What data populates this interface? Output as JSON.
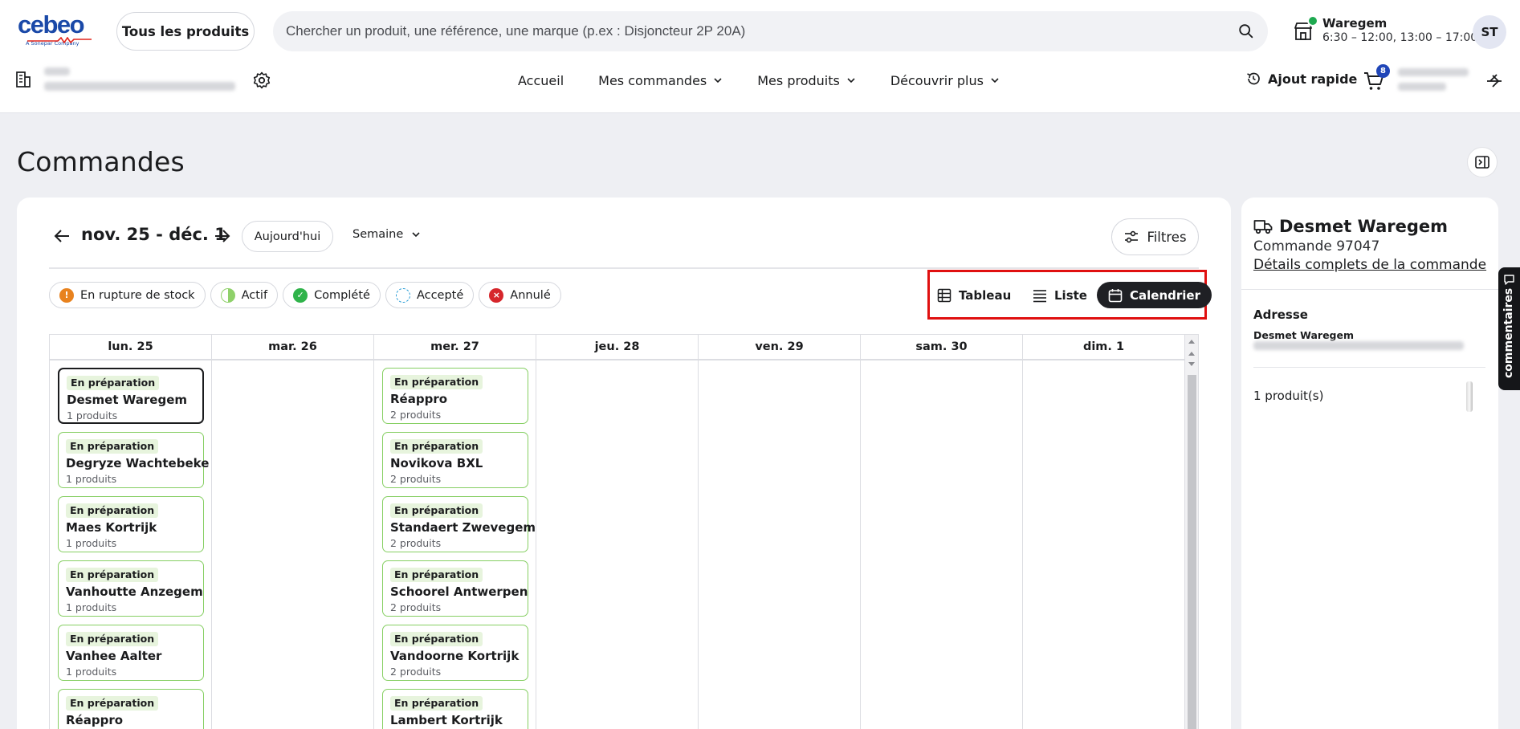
{
  "header": {
    "logo_text": "cebeo",
    "logo_tagline": "A Sonepar Company",
    "all_products_label": "Tous les produits",
    "search_placeholder": "Chercher un produit, une référence, une marque (p.ex : Disjoncteur 2P 20A)",
    "store_name": "Waregem",
    "store_hours": "6:30 – 12:00, 13:00 – 17:00",
    "avatar_initials": "ST",
    "nav": [
      "Accueil",
      "Mes commandes",
      "Mes produits",
      "Découvrir plus"
    ],
    "quick_add_label": "Ajout rapide",
    "cart_count": "8"
  },
  "page": {
    "title": "Commandes"
  },
  "toolbar": {
    "date_range": "nov. 25 - déc. 1",
    "today_label": "Aujourd'hui",
    "period_label": "Semaine",
    "filters_label": "Filtres"
  },
  "legend": [
    {
      "label": "En rupture de stock",
      "color": "#e8821e",
      "icon": "warning-icon"
    },
    {
      "label": "Actif",
      "color": "#8fd16a",
      "icon": "half-circle-icon"
    },
    {
      "label": "Complété",
      "color": "#2fb34a",
      "icon": "check-circle-icon"
    },
    {
      "label": "Accepté",
      "color": "#2a9dd6",
      "icon": "dashed-circle-icon"
    },
    {
      "label": "Annulé",
      "color": "#d6262b",
      "icon": "cancel-icon"
    }
  ],
  "views": {
    "table_label": "Tableau",
    "list_label": "Liste",
    "calendar_label": "Calendrier",
    "active": "Calendrier"
  },
  "calendar": {
    "days": [
      "lun. 25",
      "mar. 26",
      "mer. 27",
      "jeu. 28",
      "ven. 29",
      "sam. 30",
      "dim. 1"
    ],
    "columns": [
      [
        {
          "status": "En préparation",
          "name": "Desmet Waregem",
          "count": "1 produits",
          "selected": true
        },
        {
          "status": "En préparation",
          "name": "Degryze Wachtebeke",
          "count": "1 produits"
        },
        {
          "status": "En préparation",
          "name": "Maes Kortrijk",
          "count": "1 produits"
        },
        {
          "status": "En préparation",
          "name": "Vanhoutte Anzegem",
          "count": "1 produits"
        },
        {
          "status": "En préparation",
          "name": "Vanhee Aalter",
          "count": "1 produits"
        },
        {
          "status": "En préparation",
          "name": "Réappro",
          "count": ""
        }
      ],
      [],
      [
        {
          "status": "En préparation",
          "name": "Réappro",
          "count": "2 produits"
        },
        {
          "status": "En préparation",
          "name": "Novikova BXL",
          "count": "2 produits"
        },
        {
          "status": "En préparation",
          "name": "Standaert Zwevegem",
          "count": "2 produits"
        },
        {
          "status": "En préparation",
          "name": "Schoorel Antwerpen",
          "count": "2 produits"
        },
        {
          "status": "En préparation",
          "name": "Vandoorne Kortrijk",
          "count": "2 produits"
        },
        {
          "status": "En préparation",
          "name": "Lambert Kortrijk",
          "count": ""
        }
      ],
      [],
      [],
      [],
      []
    ]
  },
  "side_panel": {
    "title": "Desmet Waregem",
    "order_label": "Commande 97047",
    "details_link": "Détails complets de la commande",
    "address_label": "Adresse",
    "address_name": "Desmet Waregem",
    "products_label": "1 produit(s)",
    "comments_label": "commentaires"
  }
}
